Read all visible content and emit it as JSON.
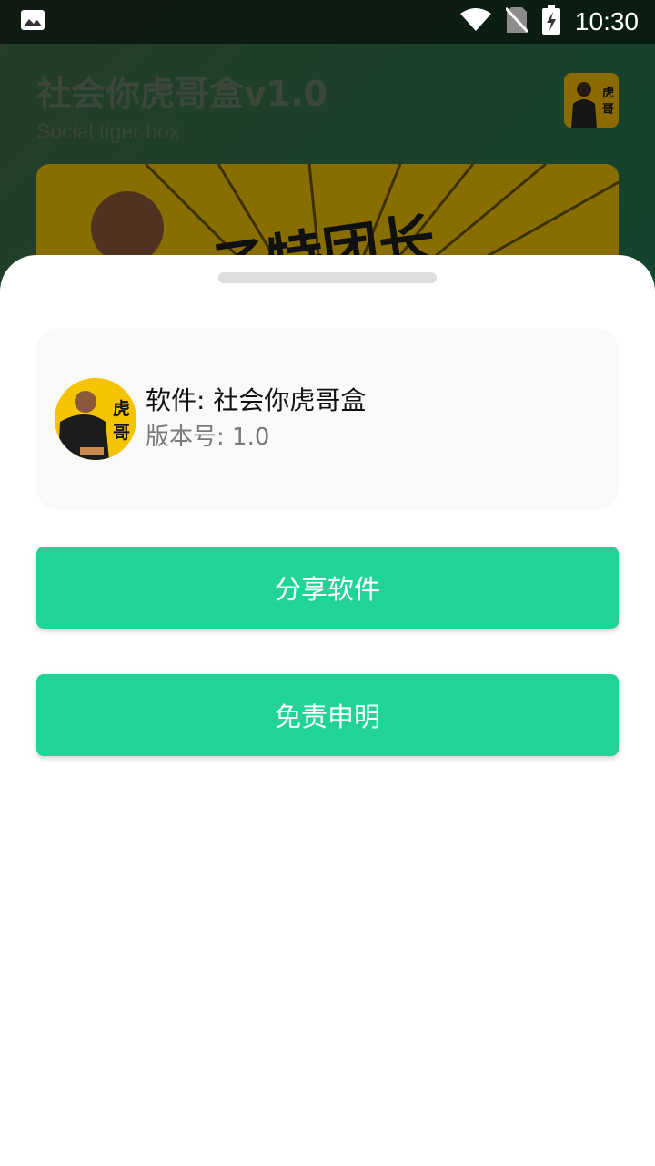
{
  "status_bar": {
    "time": "10:30",
    "icons": [
      "image-icon",
      "wifi-icon",
      "no-sim-icon",
      "battery-charging-icon"
    ]
  },
  "app": {
    "title": "社会你虎哥盒v1.0",
    "subtitle": "Social tiger box",
    "logo_text": "虎\n哥",
    "banner_text": "子特团长"
  },
  "sheet": {
    "info": {
      "avatar_text_1": "虎",
      "avatar_text_2": "哥",
      "name_label": "软件: 社会你虎哥盒",
      "version_label": "版本号: 1.0"
    },
    "buttons": {
      "share": "分享软件",
      "disclaimer": "免责申明"
    }
  },
  "colors": {
    "accent": "#21d396",
    "sheet_bg": "#ffffff",
    "card_bg": "#f9f9f9"
  }
}
